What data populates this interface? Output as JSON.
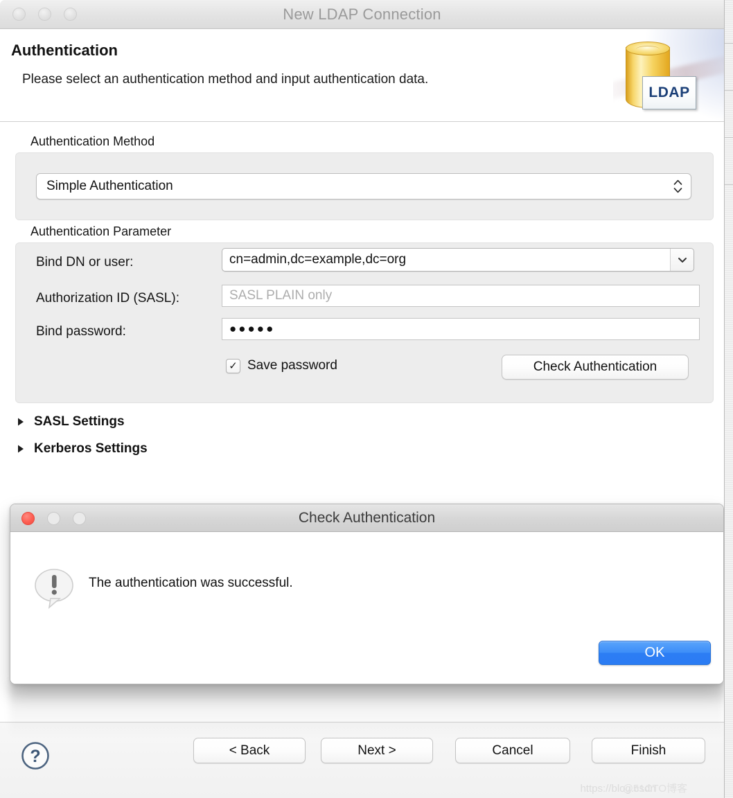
{
  "window": {
    "title": "New LDAP Connection",
    "traffic_lights": [
      "close-button",
      "minimize-button",
      "zoom-button"
    ]
  },
  "header": {
    "title": "Authentication",
    "description": "Please select an authentication method and input authentication data.",
    "icon_label": "LDAP",
    "icon_name": "ldap-database-icon"
  },
  "auth_method": {
    "legend": "Authentication Method",
    "selected": "Simple Authentication"
  },
  "auth_parameter": {
    "legend": "Authentication Parameter",
    "bind_dn": {
      "label": "Bind DN or user:",
      "value": "cn=admin,dc=example,dc=org"
    },
    "authz_id": {
      "label": "Authorization ID (SASL):",
      "value": "",
      "placeholder": "SASL PLAIN only"
    },
    "bind_password": {
      "label": "Bind password:",
      "value": "●●●●●"
    },
    "save_password": {
      "label": "Save password",
      "checked": true,
      "check_glyph": "✓"
    },
    "check_auth_button": "Check Authentication"
  },
  "expandable_sections": [
    {
      "label": "SASL Settings",
      "expanded": false
    },
    {
      "label": "Kerberos Settings",
      "expanded": false
    }
  ],
  "dialog": {
    "title": "Check Authentication",
    "message": "The authentication was successful.",
    "icon_name": "speech-bubble-exclamation-icon",
    "ok_label": "OK",
    "ok_color": "#2c7df4"
  },
  "footer": {
    "help_label": "?",
    "buttons": [
      {
        "label": "< Back",
        "name": "back-button"
      },
      {
        "label": "Next >",
        "name": "next-button"
      },
      {
        "label": "Cancel",
        "name": "cancel-button"
      },
      {
        "label": "Finish",
        "name": "finish-button"
      }
    ],
    "watermark_a": "https://blog.csdn",
    "watermark_b": "@51CTO博客"
  }
}
